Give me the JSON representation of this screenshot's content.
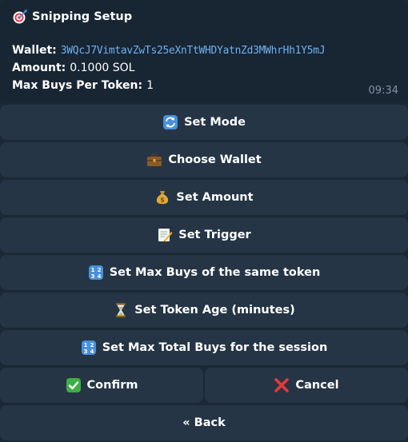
{
  "message": {
    "title": "Snipping Setup",
    "title_icon": "target-dart-icon",
    "wallet_label": "Wallet:",
    "wallet_value": "3WQcJ7VimtavZwTs25eXnTtWHDYatnZd3MWhrHh1Y5mJ",
    "amount_label": "Amount:",
    "amount_value": "0.1000 SOL",
    "maxbuys_label": "Max Buys Per Token:",
    "maxbuys_value": "1",
    "time": "09:34"
  },
  "buttons": {
    "set_mode": {
      "label": "Set Mode",
      "icon": "refresh-arrows-icon"
    },
    "choose_wallet": {
      "label": "Choose Wallet",
      "icon": "briefcase-icon"
    },
    "set_amount": {
      "label": "Set Amount",
      "icon": "money-bag-icon"
    },
    "set_trigger": {
      "label": "Set Trigger",
      "icon": "memo-pencil-icon"
    },
    "set_max_buys_token": {
      "label": "Set Max Buys of the same token",
      "icon": "numbers-1234-icon"
    },
    "set_token_age": {
      "label": "Set Token Age (minutes)",
      "icon": "hourglass-icon"
    },
    "set_max_total_buys": {
      "label": "Set Max Total Buys for the session",
      "icon": "numbers-1234-icon"
    },
    "confirm": {
      "label": "Confirm",
      "icon": "green-check-icon"
    },
    "cancel": {
      "label": "Cancel",
      "icon": "red-cross-icon"
    },
    "back": {
      "label": "« Back"
    }
  },
  "colors": {
    "background": "#1b2836",
    "message_bubble": "#182533",
    "button": "#253545",
    "link": "#6fb2f0",
    "timestamp": "#8394a5"
  }
}
